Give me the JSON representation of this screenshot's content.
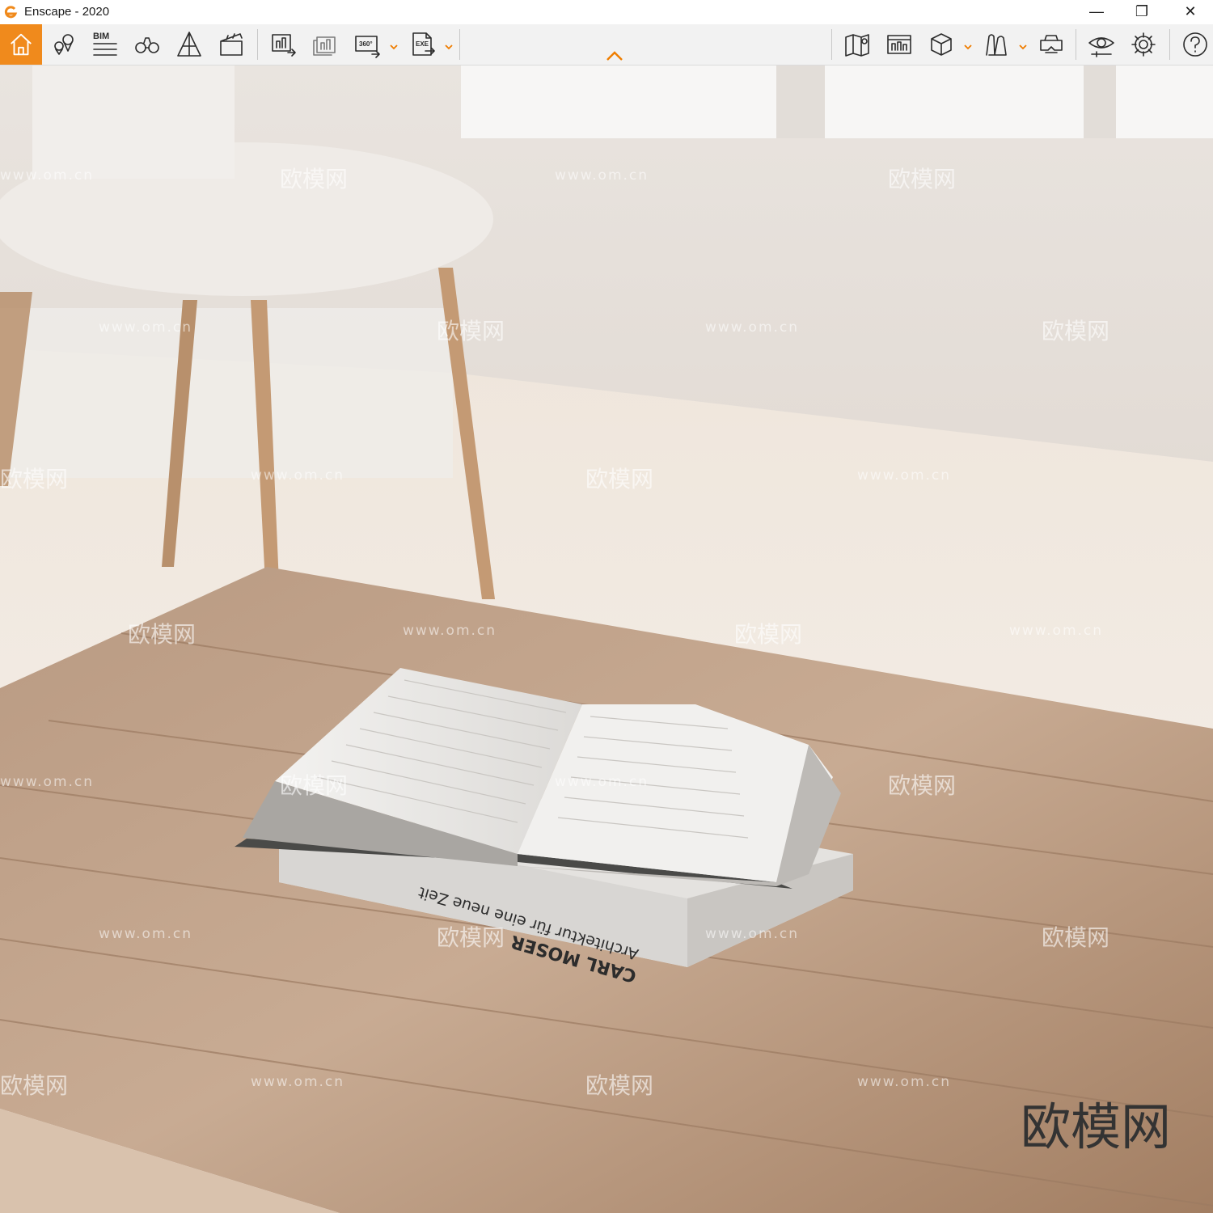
{
  "window": {
    "title": "Enscape - 2020",
    "minimize_glyph": "—",
    "maximize_glyph": "❐",
    "close_glyph": "✕"
  },
  "toolbar": {
    "bim_label": "BIM",
    "panorama_label": "360°",
    "exe_label": "EXE",
    "accent_color": "#f08a1c",
    "icons_left": [
      "home-icon",
      "location-pins-icon",
      "bim-list-icon",
      "binoculars-icon",
      "perspective-icon",
      "clapperboard-icon",
      "screenshot-icon",
      "batch-render-icon",
      "panorama-360-icon",
      "exe-export-icon"
    ],
    "icons_right": [
      "map-icon",
      "views-list-icon",
      "cube-icon",
      "asset-library-icon",
      "vr-headset-icon",
      "visual-settings-icon",
      "gear-icon",
      "help-icon"
    ]
  },
  "viewport": {
    "book_spine_title": "CARL MOSER",
    "book_spine_subtitle": "Architektur für eine neue Zeit",
    "watermark_url": "www.om.cn",
    "watermark_cn": "欧模网",
    "brand_mark": "欧模网"
  }
}
